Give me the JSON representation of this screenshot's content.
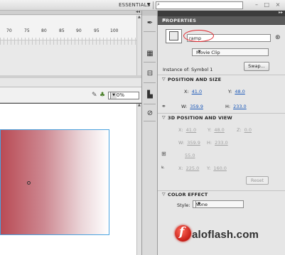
{
  "app": {
    "workspace_label": "ESSENTIALS",
    "search_placeholder": "",
    "window_controls": "– □ ×"
  },
  "timeline": {
    "frame_numbers": [
      "70",
      "75",
      "80",
      "85",
      "90",
      "95",
      "100"
    ]
  },
  "stage_toolbar": {
    "zoom": "100%"
  },
  "properties": {
    "panel_title": "PROPERTIES",
    "instance_name": "ramp",
    "symbol_type": "Movie Clip",
    "instance_of_label": "Instance of:",
    "instance_of_value": "Symbol 1",
    "swap_label": "Swap...",
    "position_size": {
      "title": "POSITION AND SIZE",
      "x_label": "X:",
      "x": "41.0",
      "y_label": "Y:",
      "y": "48.0",
      "w_label": "W:",
      "w": "359.9",
      "h_label": "H:",
      "h": "233.0"
    },
    "position_3d": {
      "title": "3D POSITION AND VIEW",
      "x_label": "X:",
      "x": "41.0",
      "y_label": "Y:",
      "y": "48.0",
      "z_label": "Z:",
      "z": "0.0",
      "w_label": "W:",
      "w": "359.9",
      "h_label": "H:",
      "h": "233.0",
      "persp": "55.0",
      "vx_label": "X:",
      "vx": "225.0",
      "vy_label": "Y:",
      "vy": "160.0",
      "reset_label": "Reset"
    },
    "color_effect": {
      "title": "COLOR EFFECT",
      "style_label": "Style:",
      "style_value": "None"
    }
  },
  "watermark": {
    "text": "aloflash.com",
    "glyph": "f"
  }
}
